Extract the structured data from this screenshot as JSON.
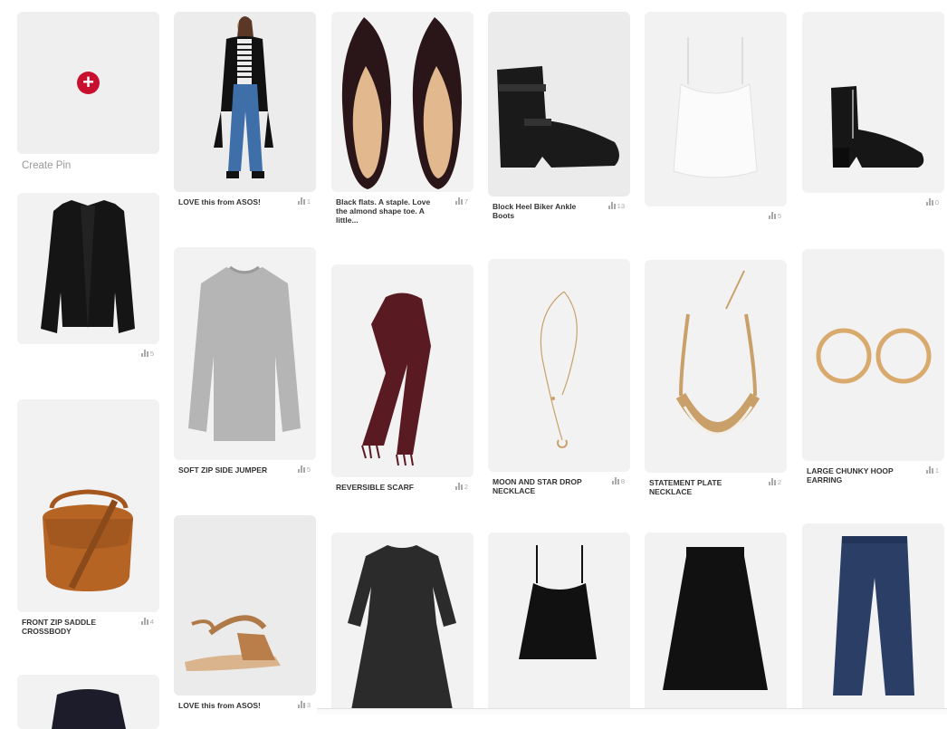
{
  "create_pin": {
    "label": "Create Pin",
    "icon": "plus-circle-icon"
  },
  "pins": [
    {
      "id": "cardigan",
      "caption": "",
      "count": "5"
    },
    {
      "id": "saddle-bag",
      "caption": "FRONT ZIP SADDLE CROSSBODY",
      "count": "4"
    },
    {
      "id": "skirt-peek",
      "caption": "",
      "count": ""
    },
    {
      "id": "asos-model",
      "caption": "LOVE this from ASOS!",
      "count": "1"
    },
    {
      "id": "grey-jumper",
      "caption": "SOFT ZIP SIDE JUMPER",
      "count": "5"
    },
    {
      "id": "sandals",
      "caption": "LOVE this from ASOS!",
      "count": "3"
    },
    {
      "id": "black-flats",
      "caption": "Black flats. A staple. Love the almond shape toe. A little...",
      "count": "7"
    },
    {
      "id": "scarf",
      "caption": "REVERSIBLE SCARF",
      "count": "2"
    },
    {
      "id": "smock-dress",
      "caption": "",
      "count": ""
    },
    {
      "id": "biker-boots",
      "caption": "Block Heel Biker Ankle Boots",
      "count": "13"
    },
    {
      "id": "moon-necklace",
      "caption": "MOON AND STAR DROP NECKLACE",
      "count": "8"
    },
    {
      "id": "black-cami",
      "caption": "",
      "count": ""
    },
    {
      "id": "white-cami",
      "caption": "",
      "count": "5"
    },
    {
      "id": "plate-necklace",
      "caption": "STATEMENT PLATE NECKLACE",
      "count": "2"
    },
    {
      "id": "midi-skirt",
      "caption": "",
      "count": ""
    },
    {
      "id": "heel-boots",
      "caption": "",
      "count": "0"
    },
    {
      "id": "hoop-earring",
      "caption": "LARGE CHUNKY HOOP EARRING",
      "count": "1"
    },
    {
      "id": "jeans",
      "caption": "",
      "count": ""
    }
  ],
  "colors": {
    "accent": "#c8102e",
    "tile": "#f2f2f2"
  }
}
